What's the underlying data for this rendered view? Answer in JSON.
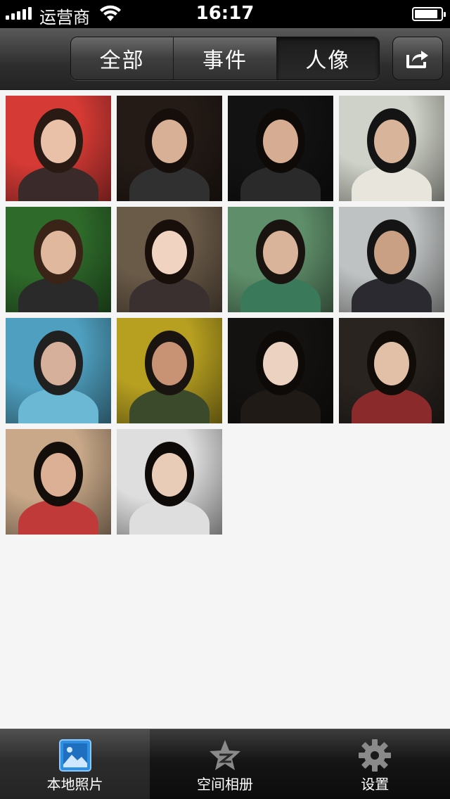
{
  "status_bar": {
    "carrier": "运营商",
    "time": "16:17",
    "battery_level": 0.9
  },
  "nav": {
    "segments": [
      {
        "label": "全部",
        "selected": false
      },
      {
        "label": "事件",
        "selected": false
      },
      {
        "label": "人像",
        "selected": true
      }
    ],
    "share_icon": "share-icon"
  },
  "photos": [
    {
      "bg": "#d63a35",
      "skin": "#e9c0a8",
      "hair": "#2a1a14",
      "cloth": "#3a2a2a"
    },
    {
      "bg": "#241b16",
      "skin": "#d8b096",
      "hair": "#160e0a",
      "cloth": "#303030"
    },
    {
      "bg": "#121212",
      "skin": "#d6ad92",
      "hair": "#0e0a08",
      "cloth": "#2a2a2a"
    },
    {
      "bg": "#cfd2c8",
      "skin": "#d8b59a",
      "hair": "#141414",
      "cloth": "#e8e6dc"
    },
    {
      "bg": "#2e6a2a",
      "skin": "#e0b89e",
      "hair": "#3a2418",
      "cloth": "#2a2a2a"
    },
    {
      "bg": "#6a5a48",
      "skin": "#f0d3c0",
      "hair": "#180e0a",
      "cloth": "#3a3030"
    },
    {
      "bg": "#5f8f6a",
      "skin": "#d9b49a",
      "hair": "#1a1410",
      "cloth": "#3a7a5a"
    },
    {
      "bg": "#bfc2c2",
      "skin": "#caa084",
      "hair": "#141414",
      "cloth": "#2a2a30"
    },
    {
      "bg": "#4fa0c0",
      "skin": "#d6b09a",
      "hair": "#202020",
      "cloth": "#6ab8d4"
    },
    {
      "bg": "#b7a020",
      "skin": "#c89274",
      "hair": "#1a1410",
      "cloth": "#3a4a2a"
    },
    {
      "bg": "#141210",
      "skin": "#ecd2c0",
      "hair": "#0e0a08",
      "cloth": "#201a16"
    },
    {
      "bg": "#2a2420",
      "skin": "#e2c0a8",
      "hair": "#120c08",
      "cloth": "#8a2a2a"
    },
    {
      "bg": "#c8a888",
      "skin": "#dcb094",
      "hair": "#140e0a",
      "cloth": "#c03a3a"
    },
    {
      "bg": "#dedede",
      "skin": "#e8ccb8",
      "hair": "#0e0a08",
      "cloth": "#dedede"
    }
  ],
  "tabs": [
    {
      "label": "本地照片",
      "icon": "photo-icon",
      "active": true
    },
    {
      "label": "空间相册",
      "icon": "qzone-star-icon",
      "active": false
    },
    {
      "label": "设置",
      "icon": "gear-icon",
      "active": false
    }
  ],
  "colors": {
    "active_icon": "#2f8fe0",
    "inactive_icon": "#8a8a8a"
  }
}
